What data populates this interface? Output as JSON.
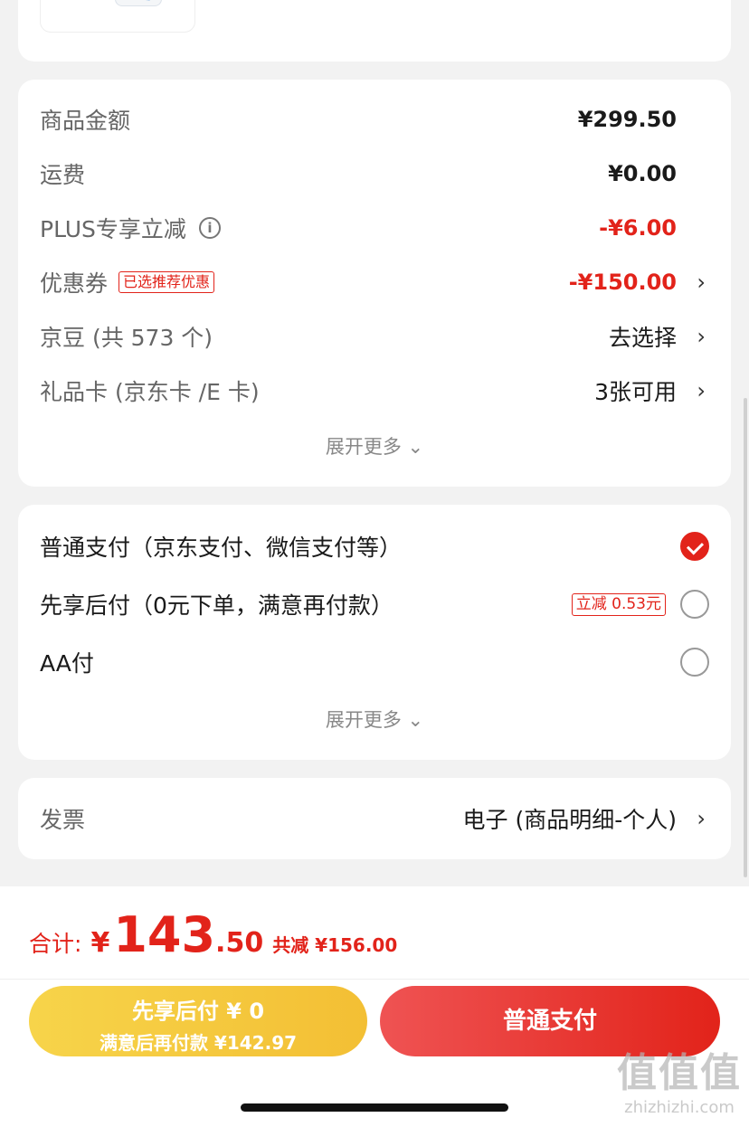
{
  "fees": {
    "rows": [
      {
        "label": "商品金额",
        "value": "¥299.50"
      },
      {
        "label": "运费",
        "value": "¥0.00"
      },
      {
        "label": "PLUS专享立减",
        "info_icon": "info-icon",
        "value": "-¥6.00"
      },
      {
        "label": "优惠券",
        "tag": "已选推荐优惠",
        "value": "-¥150.00",
        "chevron": "›"
      },
      {
        "label": "京豆 (共 573 个)",
        "value": "去选择",
        "chevron": "›"
      },
      {
        "label": "礼品卡 (京东卡 /E 卡)",
        "value": "3张可用",
        "chevron": "›"
      }
    ],
    "expand": "展开更多 ⌄"
  },
  "payment": {
    "options": [
      {
        "label": "普通支付（京东支付、微信支付等）",
        "selected": true
      },
      {
        "label": "先享后付（0元下单，满意再付款）",
        "tag": "立减 0.53元",
        "selected": false
      },
      {
        "label": "AA付",
        "selected": false
      }
    ],
    "expand": "展开更多 ⌄"
  },
  "invoice": {
    "label": "发票",
    "value": "电子 (商品明细-个人)",
    "chevron": "›"
  },
  "footer": {
    "total_label": "合计:",
    "yen": "¥",
    "total_int": "143",
    "total_dec": ".50",
    "save": "共减 ¥156.00",
    "btn_later_line1": "先享后付 ¥ 0",
    "btn_later_line2": "满意后再付款 ¥142.97",
    "btn_normal": "普通支付"
  },
  "watermark": {
    "logo": "值值值",
    "url": "zhizhizhi.com"
  },
  "colors": {
    "accent_red": "#e2231a",
    "yellow_button": "#f3bf34",
    "background": "#f2f2f2"
  }
}
